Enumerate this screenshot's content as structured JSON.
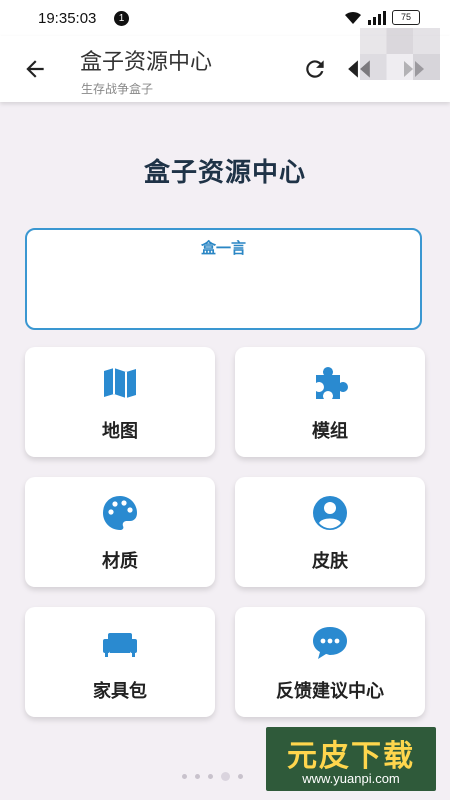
{
  "status_bar": {
    "time": "19:35:03",
    "notification_count": "1",
    "battery": "75"
  },
  "app_bar": {
    "title": "盒子资源中心",
    "subtitle": "生存战争盒子"
  },
  "main": {
    "title": "盒子资源中心",
    "quote_title": "盒一言",
    "cards": [
      {
        "label": "地图",
        "icon": "map-icon"
      },
      {
        "label": "模组",
        "icon": "puzzle-icon"
      },
      {
        "label": "材质",
        "icon": "palette-icon"
      },
      {
        "label": "皮肤",
        "icon": "account-icon"
      },
      {
        "label": "家具包",
        "icon": "sofa-icon"
      },
      {
        "label": "反馈建议中心",
        "icon": "chat-icon"
      }
    ]
  },
  "watermark": {
    "main": "元皮下载",
    "url": "www.yuanpi.com"
  },
  "colors": {
    "accent": "#3a97d1",
    "title": "#1f3347",
    "background": "#f3eff4"
  }
}
